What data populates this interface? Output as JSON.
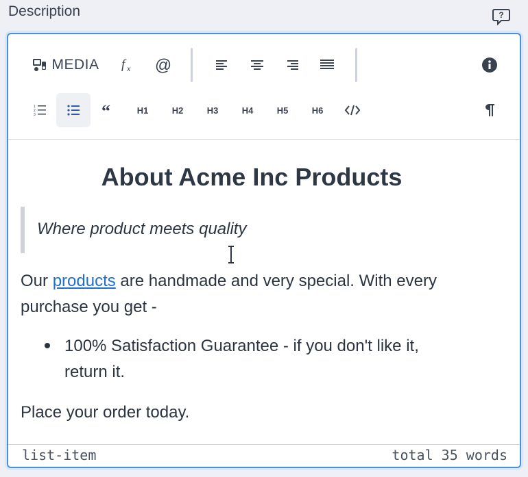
{
  "field": {
    "label": "Description"
  },
  "toolbar": {
    "media_label": "MEDIA",
    "headings": [
      "H1",
      "H2",
      "H3",
      "H4",
      "H5",
      "H6"
    ]
  },
  "content": {
    "title": "About Acme Inc Products",
    "quote": "Where product meets quality",
    "para1_before": "Our ",
    "para1_link": "products",
    "para1_line1_after": " are handmade and very special. With every",
    "para1_line2": "purchase you get -",
    "bullet_line1": "100% Satisfaction Guarantee - if you don't like it,",
    "bullet_line2": "return it.",
    "para2": "Place your order today."
  },
  "status": {
    "element_path": "list-item",
    "word_count": "total 35 words"
  },
  "colors": {
    "accent": "#4a90d9",
    "link": "#1f6fd0",
    "text": "#2b3440",
    "background": "#eef0f6"
  }
}
